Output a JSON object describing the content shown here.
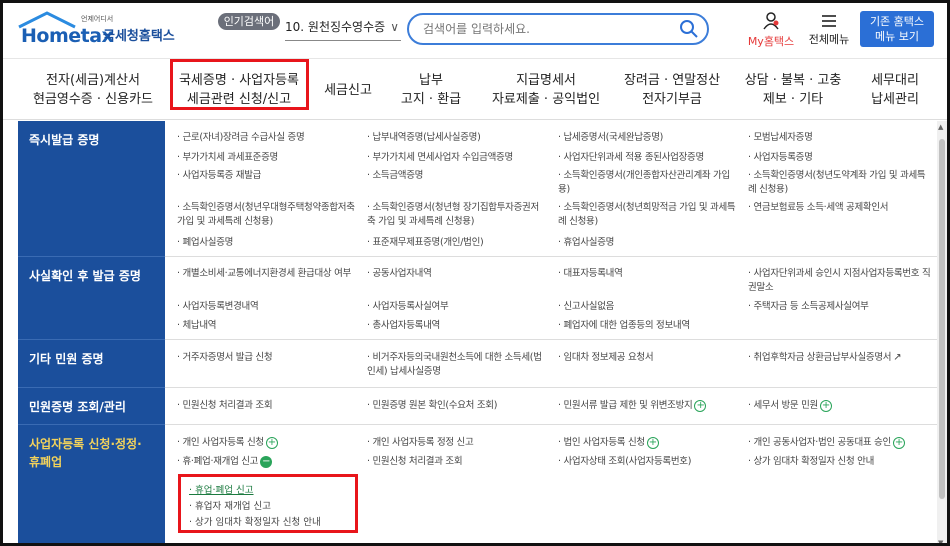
{
  "header": {
    "logo_small": "언제어디서",
    "logo_brand": "Hometax",
    "logo_kor": "국세청홈택스",
    "popular_label": "인기검색어",
    "popular_selected": "10. 원천징수영수증",
    "search_placeholder": "검색어를 입력하세요.",
    "my_home": "My홈택스",
    "all_menu": "전체메뉴",
    "old_home": "기존 홈택스\n메뉴 보기"
  },
  "gnb": [
    "전자(세금)계산서\n현금영수증 · 신용카드",
    "국세증명 · 사업자등록\n세금관련 신청/신고",
    "세금신고",
    "납부\n고지 · 환급",
    "지급명세서\n자료제출 · 공익법인",
    "장려금 · 연말정산\n전자기부금",
    "상담 · 불복 · 고충\n제보 · 기타",
    "세무대리\n납세관리"
  ],
  "sections": [
    {
      "title": "즉시발급 증명",
      "items": [
        "· 근로(자녀)장려금 수급사실 증명",
        "· 납부내역증명(납세사실증명)",
        "· 납세증명서(국세완납증명)",
        "· 모범납세자증명",
        "· 부가가치세 과세표준증명",
        "· 부가가치세 면세사업자 수입금액증명",
        "· 사업자단위과세 적용 종된사업장증명",
        "· 사업자등록증명",
        "· 사업자등록증 재발급",
        "· 소득금액증명",
        "· 소득확인증명서(개인종합자산관리계좌 가입용)",
        "· 소득확인증명서(청년도약계좌 가입 및 과세특례 신청용)",
        "· 소득확인증명서(청년우대형주택청약종합저축 가입 및 과세특례 신청용)",
        "· 소득확인증명서(청년형 장기집합투자증권저축 가입 및 과세특례 신청용)",
        "· 소득확인증명서(청년희망적금 가입 및 과세특례 신청용)",
        "· 연금보험료등 소득·세액 공제확인서",
        "· 폐업사실증명",
        "· 표준재무제표증명(개인/법인)",
        "· 휴업사실증명",
        ""
      ]
    },
    {
      "title": "사실확인 후 발급 증명",
      "items": [
        "· 개별소비세·교통에너지환경세 환급대상 여부",
        "· 공동사업자내역",
        "· 대표자등록내역",
        "· 사업자단위과세 승인시 지점사업자등록번호 직권말소",
        "· 사업자등록변경내역",
        "· 사업자등록사실여부",
        "· 신고사실없음",
        "· 주택자금 등 소득공제사실여부",
        "· 체납내역",
        "· 총사업자등록내역",
        "· 폐업자에 대한 업종등의 정보내역",
        ""
      ]
    },
    {
      "title": "기타 민원 증명",
      "items": [
        "· 거주자증명서 발급 신청",
        "· 비거주자등의국내원천소득에 대한 소득세(법인세) 납세사실증명",
        "· 임대차 정보제공 요청서",
        "· 취업후학자금 상환금납부사실증명서"
      ]
    },
    {
      "title": "민원증명 조회/관리",
      "items": [
        "· 민원신청 처리결과 조회",
        "· 민원증명 원본 확인(수요처 조회)",
        "· 민원서류 발급 제한 및 위변조방지",
        "· 세무서 방문 민원"
      ]
    },
    {
      "title": "사업자등록 신청·정정·\n휴폐업",
      "items": [
        "· 개인 사업자등록 신청",
        "· 개인 사업자등록 정정 신고",
        "· 법인 사업자등록 신청",
        "· 개인 공동사업자·법인 공동대표 승인",
        "· 휴·폐업·재개업 신고",
        "· 민원신청 처리결과 조회",
        "· 사업자상태 조회(사업자등록번호)",
        "· 상가 임대차 확정일자 신청 안내"
      ]
    }
  ],
  "submenu": [
    "· 휴업·폐업 신고",
    "· 휴업자 재개업 신고",
    "· 상가 임대차 확정일자 신청 안내"
  ],
  "colors": {
    "brand": "#1b4f9c",
    "highlight": "#e8151b",
    "active_cat": "#f2d25b",
    "plus": "#2aa45a"
  }
}
